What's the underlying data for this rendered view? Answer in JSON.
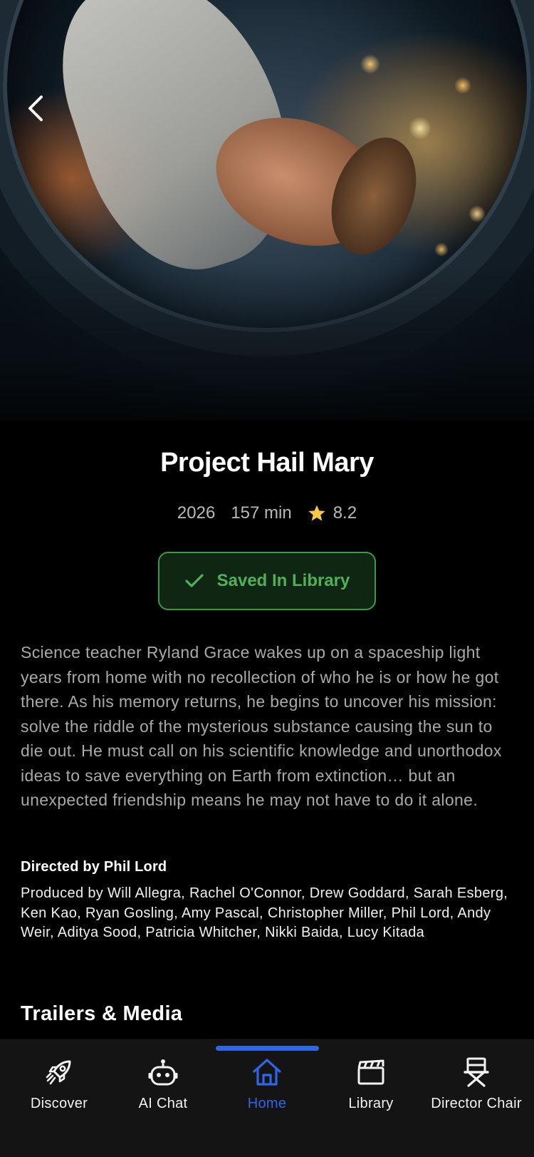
{
  "hero": {
    "back_icon": "chevron-left-icon"
  },
  "movie": {
    "title": "Project Hail Mary",
    "year": "2026",
    "runtime": "157 min",
    "rating": "8.2",
    "rating_icon": "star-icon",
    "saved_label": "Saved In Library",
    "saved_icon": "check-icon",
    "synopsis": "Science teacher Ryland Grace wakes up on a spaceship light years from home with no recollection of who he is or how he got there. As his memory returns, he begins to uncover his mission: solve the riddle of the mysterious substance causing the sun to die out. He must call on his scientific knowledge and unorthodox ideas to save everything on Earth from extinction… but an unexpected friendship means he may not have to do it alone.",
    "director": "Directed by Phil Lord",
    "producers": "Produced by Will Allegra, Rachel O'Connor, Drew Goddard, Sarah Esberg, Ken Kao, Ryan Gosling, Amy Pascal, Christopher Miller, Phil Lord, Andy Weir, Aditya Sood, Patricia Whitcher, Nikki Baida, Lucy Kitada"
  },
  "sections": {
    "trailers_title": "Trailers & Media"
  },
  "tabbar": {
    "active": "Home",
    "accent_color": "#2f66e8",
    "tabs": [
      {
        "label": "Discover",
        "icon": "rocket-icon"
      },
      {
        "label": "AI Chat",
        "icon": "robot-icon"
      },
      {
        "label": "Home",
        "icon": "home-icon"
      },
      {
        "label": "Library",
        "icon": "clapperboard-icon"
      },
      {
        "label": "Director Chair",
        "icon": "director-chair-icon"
      }
    ]
  },
  "colors": {
    "background": "#000000",
    "saved_green": "#4fb05a",
    "star_yellow": "#f5c84a"
  }
}
